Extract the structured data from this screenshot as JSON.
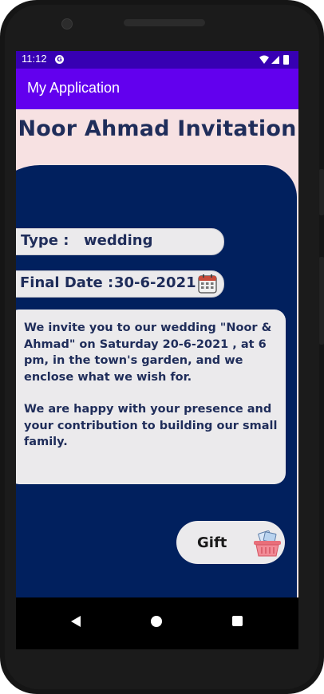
{
  "status_bar": {
    "time": "11:12",
    "notification_icon": "g-circle-icon",
    "icons": [
      "wifi-icon",
      "signal-icon",
      "battery-icon"
    ]
  },
  "app_bar": {
    "title": "My Application"
  },
  "page": {
    "title": "Noor Ahmad Invitation"
  },
  "invitation": {
    "type_label": "Type :",
    "type_value": "wedding",
    "date_label": "Final Date :",
    "date_value": "30-6-2021",
    "message_paragraph_1": "We invite you to our wedding \"Noor & Ahmad\" on Saturday 20-6-2021 , at 6 pm, in the town's garden, and we enclose what we wish for.",
    "message_paragraph_2": "We are happy with your presence and your contribution to building our small family."
  },
  "gift_button": {
    "label": "Gift",
    "icon": "basket-icon"
  },
  "nav_bar": {
    "buttons": [
      "back-icon",
      "home-icon",
      "recents-icon"
    ]
  },
  "colors": {
    "status_bar": "#3700b3",
    "app_bar": "#6200ee",
    "card": "#01205e",
    "page_background": "#f7e1e2",
    "text_dark": "#1f2d5a",
    "pill": "#ebeaec"
  }
}
